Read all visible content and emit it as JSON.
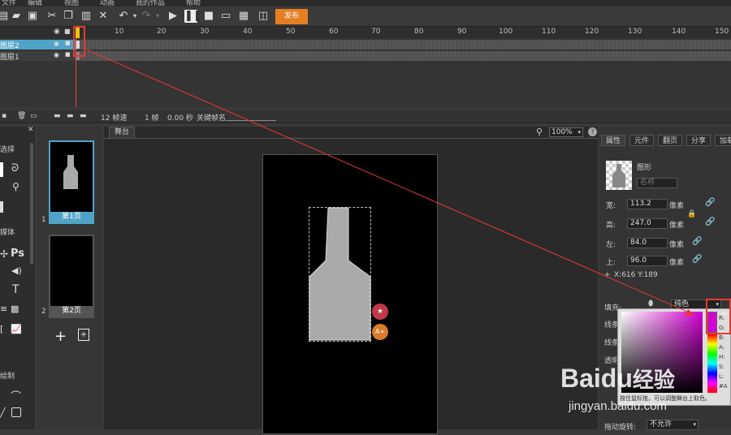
{
  "menu": [
    "文件",
    "编辑",
    "视图",
    "动画",
    "我的作品",
    "帮助"
  ],
  "toolbar": {
    "publish_label": "发布"
  },
  "ruler": [
    "10",
    "20",
    "30",
    "40",
    "50",
    "60",
    "70",
    "80",
    "90",
    "100",
    "110",
    "120",
    "130",
    "140",
    "150"
  ],
  "layers": [
    {
      "name": "图层2"
    },
    {
      "name": "图层1"
    }
  ],
  "timeline_status": {
    "fps": "12 帧速",
    "frame": "1 帧",
    "time": "0.00 秒",
    "keyframe_label": "关键帧名"
  },
  "tools": {
    "select_label": "选择",
    "media_label": "媒体",
    "draw_label": "绘制"
  },
  "pages": [
    {
      "num": "1",
      "label": "第1页"
    },
    {
      "num": "2",
      "label": "第2页"
    }
  ],
  "stage": {
    "tab": "舞台",
    "zoom": "100%"
  },
  "props": {
    "tabs": [
      "属性",
      "元件",
      "翻页",
      "分享",
      "加载"
    ],
    "shape_label": "图形",
    "name_placeholder": "名称",
    "width_label": "宽:",
    "width": "113.2",
    "height_label": "高:",
    "height": "247.0",
    "left_label": "左:",
    "left": "84.0",
    "top_label": "上:",
    "top": "96.0",
    "unit": "像素",
    "coords": "X:616    Y:189",
    "fill_label": "填充:",
    "fill_type": "纯色",
    "stroke_label": "线条:",
    "stroke2_label": "线条色:",
    "opacity_label": "透明:",
    "drag_rotate_label": "拖动旋转:",
    "drag_rotate_value": "不允许",
    "picker_hint": "按住鼠标拖，可以调整舞台上取色。"
  },
  "watermark": {
    "brand": "Baidu",
    "brand2": "经验",
    "url": "jingyan.baidu.com"
  },
  "colors": {
    "accent": "#e67e22",
    "selection": "#4fa3c7",
    "annotation": "#e53935"
  }
}
